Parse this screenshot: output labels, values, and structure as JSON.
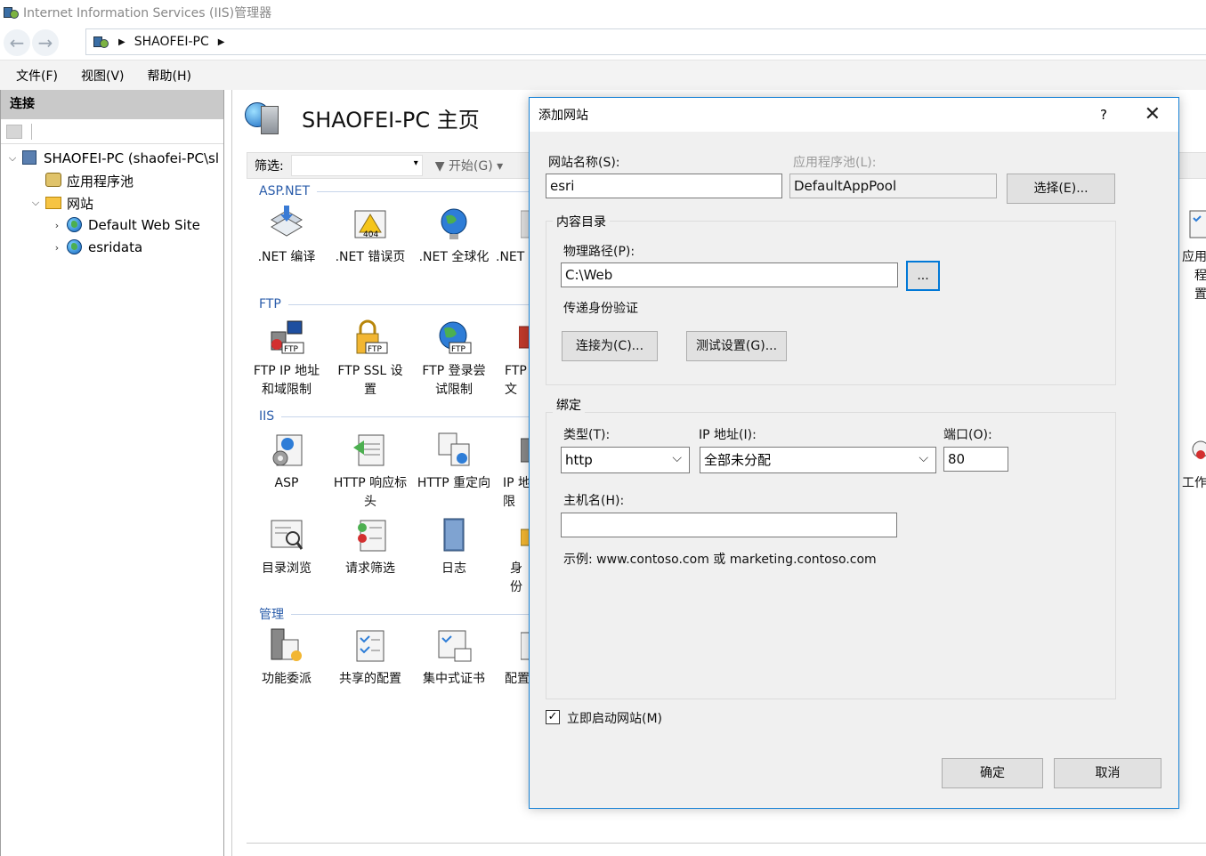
{
  "window": {
    "title": "Internet Information Services (IIS)管理器"
  },
  "address": {
    "server": "SHAOFEI-PC"
  },
  "menu": {
    "file": "文件(F)",
    "view": "视图(V)",
    "help": "帮助(H)"
  },
  "connections": {
    "header": "连接",
    "tree": {
      "server": "SHAOFEI-PC (shaofei-PC\\sl",
      "app_pools": "应用程序池",
      "sites": "网站",
      "site1": "Default Web Site",
      "site2": "esridata"
    }
  },
  "main": {
    "title": "SHAOFEI-PC 主页",
    "filter_label": "筛选:",
    "go_label": "开始(G)",
    "sections": {
      "aspnet": "ASP.NET",
      "ftp": "FTP",
      "iis": "IIS",
      "mgmt": "管理"
    },
    "features": {
      "net_compile": ".NET 编译",
      "net_error": ".NET 错误页",
      "net_global": ".NET 全球化",
      "net_more": ".NET",
      "ftp_ip": "FTP IP 地址\n和域限制",
      "ftp_ssl": "FTP SSL 设\n置",
      "ftp_logon": "FTP 登录尝\n试限制",
      "ftp_more": "FTP\n文",
      "asp": "ASP",
      "http_headers": "HTTP 响应标\n头",
      "http_redirect": "HTTP 重定向",
      "ip_more": "IP 地\n限",
      "dir_browse": "目录浏览",
      "req_filter": "请求筛选",
      "logging": "日志",
      "auth_more": "身份",
      "feat_deleg": "功能委派",
      "shared_cfg": "共享的配置",
      "central_cert": "集中式证书",
      "cfg_more": "配置",
      "right_app": "应用程\n置",
      "right_work": "工作"
    }
  },
  "dialog": {
    "title": "添加网站",
    "help": "?",
    "site_name_label": "网站名称(S):",
    "site_name_value": "esri",
    "app_pool_label": "应用程序池(L):",
    "app_pool_value": "DefaultAppPool",
    "select_button": "选择(E)...",
    "content_dir_label": "内容目录",
    "physical_path_label": "物理路径(P):",
    "physical_path_value": "C:\\Web",
    "browse_button": "...",
    "pass_auth_label": "传递身份验证",
    "connect_as_button": "连接为(C)...",
    "test_settings_button": "测试设置(G)...",
    "binding_label": "绑定",
    "type_label": "类型(T):",
    "type_value": "http",
    "ip_label": "IP 地址(I):",
    "ip_value": "全部未分配",
    "port_label": "端口(O):",
    "port_value": "80",
    "host_label": "主机名(H):",
    "host_value": "",
    "example_text": "示例: www.contoso.com 或 marketing.contoso.com",
    "start_now_label": "立即启动网站(M)",
    "start_now_checked": true,
    "ok_button": "确定",
    "cancel_button": "取消"
  }
}
